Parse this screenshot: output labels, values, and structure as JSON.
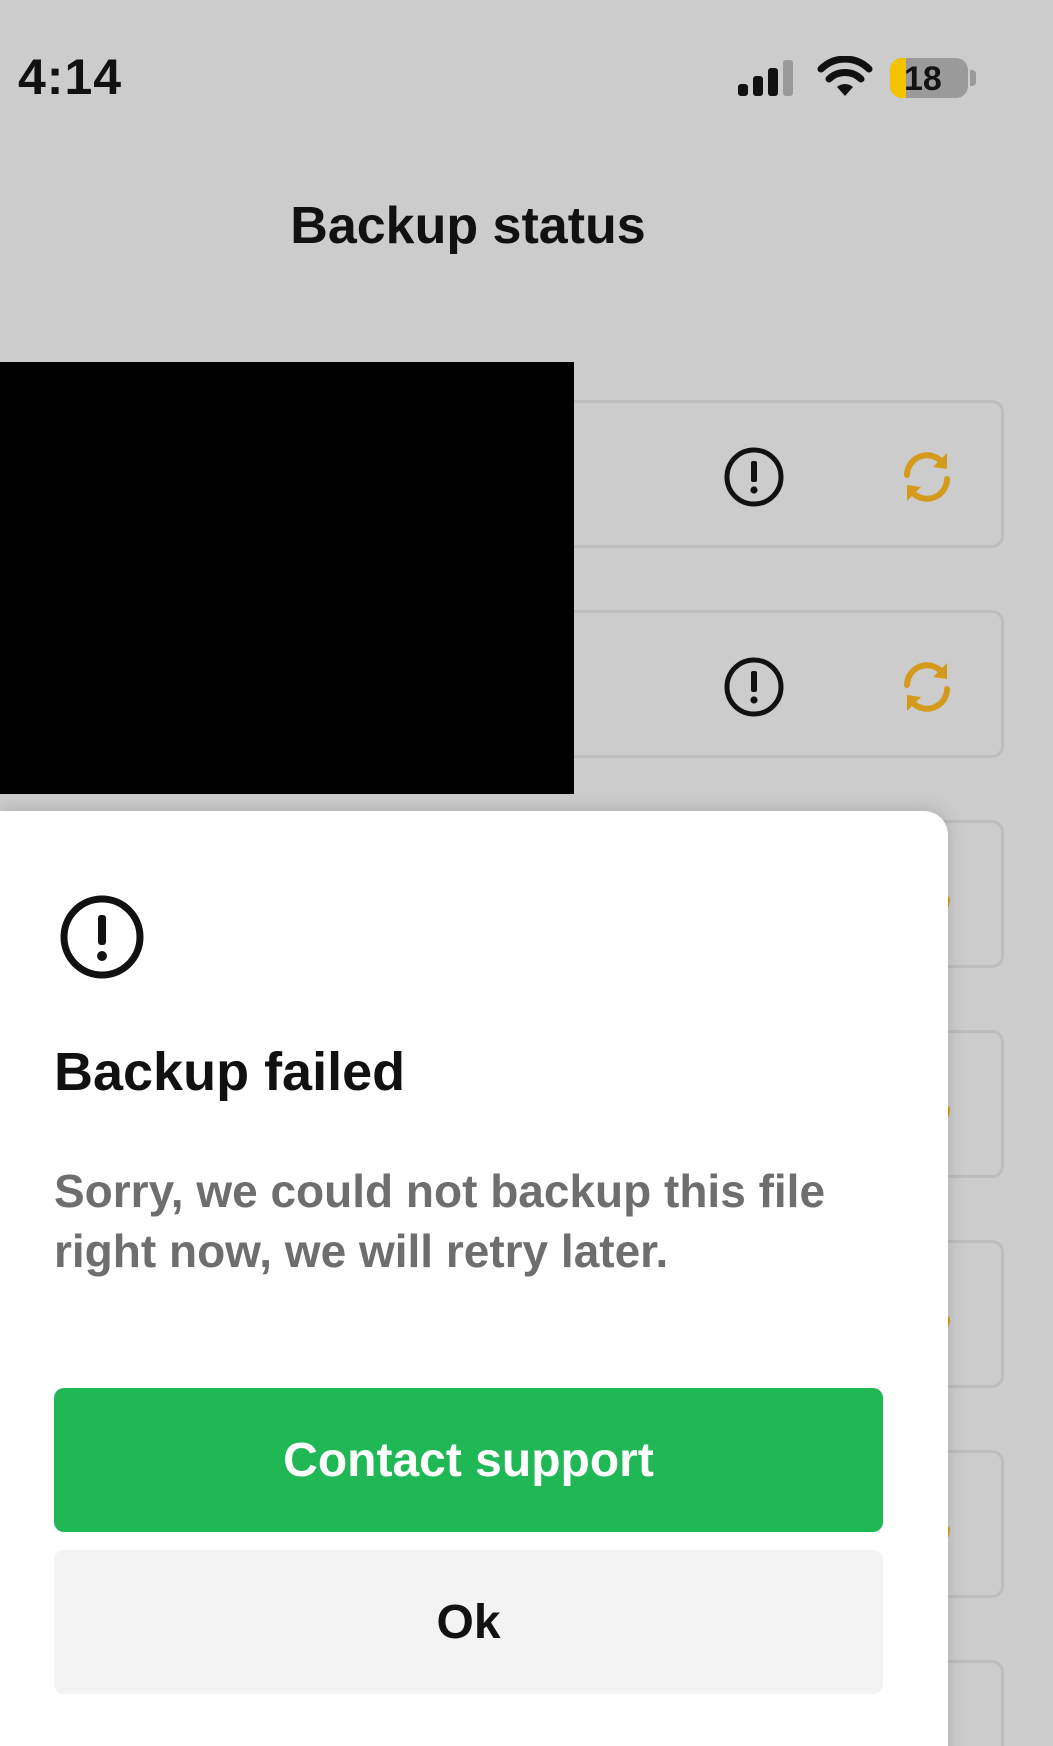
{
  "status_bar": {
    "time": "4:14",
    "battery": "18"
  },
  "header": {
    "title": "Backup status"
  },
  "rows": [
    {
      "status_icon": "alert-circle-icon",
      "action_icon": "sync-icon"
    },
    {
      "status_icon": "alert-circle-icon",
      "action_icon": "sync-icon"
    },
    {
      "status_icon": "alert-circle-icon",
      "action_icon": "sync-icon"
    },
    {
      "status_icon": "alert-circle-icon",
      "action_icon": "sync-icon"
    },
    {
      "status_icon": "alert-circle-icon",
      "action_icon": "sync-icon"
    },
    {
      "status_icon": "alert-circle-icon",
      "action_icon": "sync-icon"
    },
    {
      "status_icon": "alert-circle-icon",
      "action_icon": "sync-icon"
    }
  ],
  "dialog": {
    "icon": "alert-circle-icon",
    "title": "Backup failed",
    "message": "Sorry, we could not backup this file right now, we will retry later.",
    "primary_label": "Contact support",
    "secondary_label": "Ok"
  },
  "colors": {
    "background": "#cccccc",
    "accent_sync": "#d49a1c",
    "primary_button": "#1fb855",
    "secondary_button": "#f3f3f3",
    "message_text": "#6e6e6e"
  }
}
